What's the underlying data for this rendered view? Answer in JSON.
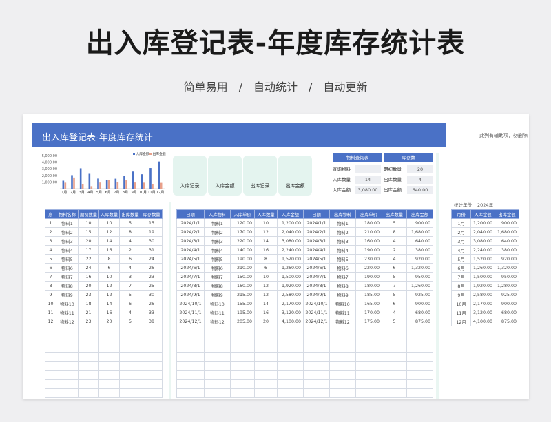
{
  "title": "出入库登记表-年度库存统计表",
  "subtitle": "简单易用　/　自动统计　/　自动更新",
  "sheet": {
    "banner": "出入库登记表-年度库存统计",
    "note": "此列有辅助项，勿删除",
    "cards": [
      "入库记录",
      "入库金额",
      "出库记录",
      "出库金额"
    ],
    "query": {
      "head_left": "物料查询表",
      "head_right": "库存数",
      "rows": [
        {
          "l1": "查询物料",
          "v1": "",
          "l2": "期初数量",
          "v2": "20"
        },
        {
          "l1": "入库数量",
          "v1": "14",
          "l2": "出库数量",
          "v2": "4"
        },
        {
          "l1": "入库金额",
          "v1": "3,080.00",
          "l2": "出库金额",
          "v2": "640.00"
        }
      ]
    },
    "stat": {
      "label": "统计年份",
      "value": "2024年"
    }
  },
  "chart_data": {
    "type": "bar",
    "categories": [
      "1月",
      "2月",
      "3月",
      "4月",
      "5月",
      "6月",
      "7月",
      "8月",
      "9月",
      "10月",
      "11月",
      "12月"
    ],
    "series": [
      {
        "name": "入库金额",
        "color": "#4a71c6",
        "values": [
          1200,
          2040,
          3080,
          2240,
          1520,
          1260,
          1500,
          1920,
          2580,
          2170,
          3120,
          4100
        ]
      },
      {
        "name": "出库金额",
        "color": "#e8a08a",
        "values": [
          900,
          1680,
          640,
          380,
          920,
          1320,
          950,
          1280,
          925,
          900,
          680,
          875
        ]
      }
    ],
    "yticks": [
      "5,000.00",
      "4,000.00",
      "3,000.00",
      "2,000.00",
      "1,000.00",
      "-"
    ],
    "ylim": [
      0,
      5000
    ]
  },
  "items_table": {
    "headers": [
      "序",
      "物料名称",
      "期初数量",
      "入库数量",
      "出库数量",
      "库存数量"
    ],
    "rows": [
      [
        "1",
        "物料1",
        "10",
        "10",
        "5",
        "15"
      ],
      [
        "2",
        "物料2",
        "15",
        "12",
        "8",
        "19"
      ],
      [
        "3",
        "物料3",
        "20",
        "14",
        "4",
        "30"
      ],
      [
        "4",
        "物料4",
        "17",
        "16",
        "2",
        "31"
      ],
      [
        "5",
        "物料5",
        "22",
        "8",
        "6",
        "24"
      ],
      [
        "6",
        "物料6",
        "24",
        "6",
        "4",
        "26"
      ],
      [
        "7",
        "物料7",
        "16",
        "10",
        "3",
        "23"
      ],
      [
        "8",
        "物料8",
        "20",
        "12",
        "7",
        "25"
      ],
      [
        "9",
        "物料9",
        "23",
        "12",
        "5",
        "30"
      ],
      [
        "10",
        "物料10",
        "18",
        "14",
        "6",
        "26"
      ],
      [
        "11",
        "物料11",
        "21",
        "16",
        "4",
        "33"
      ],
      [
        "12",
        "物料12",
        "23",
        "20",
        "5",
        "38"
      ]
    ]
  },
  "main_table": {
    "headers": [
      "日期",
      "入库物料",
      "入库单价",
      "入库数量",
      "入库金额",
      "日期",
      "出库物料",
      "出库单价",
      "出库数量",
      "出库金额"
    ],
    "rows": [
      [
        "2024/1/1",
        "物料1",
        "120.00",
        "10",
        "1,200.00",
        "2024/1/1",
        "物料1",
        "180.00",
        "5",
        "900.00"
      ],
      [
        "2024/2/1",
        "物料2",
        "170.00",
        "12",
        "2,040.00",
        "2024/2/1",
        "物料2",
        "210.00",
        "8",
        "1,680.00"
      ],
      [
        "2024/3/1",
        "物料3",
        "220.00",
        "14",
        "3,080.00",
        "2024/3/1",
        "物料3",
        "160.00",
        "4",
        "640.00"
      ],
      [
        "2024/4/1",
        "物料4",
        "140.00",
        "16",
        "2,240.00",
        "2024/4/1",
        "物料4",
        "190.00",
        "2",
        "380.00"
      ],
      [
        "2024/5/1",
        "物料5",
        "190.00",
        "8",
        "1,520.00",
        "2024/5/1",
        "物料5",
        "230.00",
        "4",
        "920.00"
      ],
      [
        "2024/6/1",
        "物料6",
        "210.00",
        "6",
        "1,260.00",
        "2024/6/1",
        "物料6",
        "220.00",
        "6",
        "1,320.00"
      ],
      [
        "2024/7/1",
        "物料7",
        "150.00",
        "10",
        "1,500.00",
        "2024/7/1",
        "物料7",
        "190.00",
        "5",
        "950.00"
      ],
      [
        "2024/8/1",
        "物料8",
        "160.00",
        "12",
        "1,920.00",
        "2024/8/1",
        "物料8",
        "180.00",
        "7",
        "1,260.00"
      ],
      [
        "2024/9/1",
        "物料9",
        "215.00",
        "12",
        "2,580.00",
        "2024/9/1",
        "物料9",
        "185.00",
        "5",
        "925.00"
      ],
      [
        "2024/10/1",
        "物料10",
        "155.00",
        "14",
        "2,170.00",
        "2024/10/1",
        "物料10",
        "165.00",
        "6",
        "900.00"
      ],
      [
        "2024/11/1",
        "物料11",
        "195.00",
        "16",
        "3,120.00",
        "2024/11/1",
        "物料11",
        "170.00",
        "4",
        "680.00"
      ],
      [
        "2024/12/1",
        "物料12",
        "205.00",
        "20",
        "4,100.00",
        "2024/12/1",
        "物料12",
        "175.00",
        "5",
        "875.00"
      ]
    ]
  },
  "month_table": {
    "headers": [
      "月份",
      "入库金额",
      "出库金额"
    ],
    "rows": [
      [
        "1月",
        "1,200.00",
        "900.00"
      ],
      [
        "2月",
        "2,040.00",
        "1,680.00"
      ],
      [
        "3月",
        "3,080.00",
        "640.00"
      ],
      [
        "4月",
        "2,240.00",
        "380.00"
      ],
      [
        "5月",
        "1,520.00",
        "920.00"
      ],
      [
        "6月",
        "1,260.00",
        "1,320.00"
      ],
      [
        "7月",
        "1,500.00",
        "950.00"
      ],
      [
        "8月",
        "1,920.00",
        "1,280.00"
      ],
      [
        "9月",
        "2,580.00",
        "925.00"
      ],
      [
        "10月",
        "2,170.00",
        "900.00"
      ],
      [
        "11月",
        "3,120.00",
        "680.00"
      ],
      [
        "12月",
        "4,100.00",
        "875.00"
      ]
    ]
  }
}
